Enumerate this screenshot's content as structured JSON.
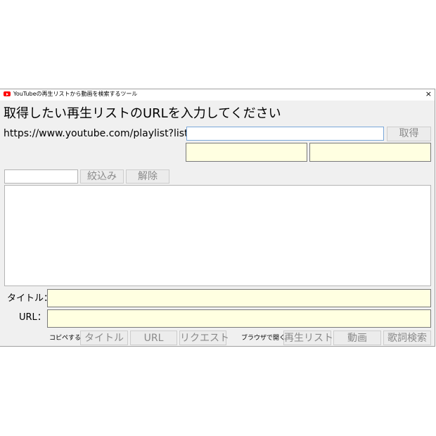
{
  "window": {
    "title": "YouTubeの再生リストから動画を検索するツール",
    "close_glyph": "×"
  },
  "heading": "取得したい再生リストのURLを入力してください",
  "url_prefix": "https://www.youtube.com/playlist?list=",
  "playlist_input": {
    "value": "",
    "placeholder": ""
  },
  "buttons": {
    "fetch": "取得",
    "filter": "絞込み",
    "clear": "解除",
    "copy_title": "タイトル",
    "copy_url": "URL",
    "copy_request": "リクエスト",
    "open_playlist": "再生リスト",
    "open_video": "動画",
    "open_lyrics": "歌詞検索"
  },
  "labels": {
    "title": "タイトル：",
    "url": "URL：",
    "copy": "コピペする",
    "browser": "ブラウザで開く"
  },
  "info_fields": {
    "left": "",
    "right": ""
  },
  "filter_input": {
    "value": ""
  },
  "result_list": [],
  "detail": {
    "title": "",
    "url": ""
  },
  "colors": {
    "readonly_field": "#ffffe1",
    "focus_border": "#7aa7d9",
    "window_bg": "#f0f0f0"
  }
}
